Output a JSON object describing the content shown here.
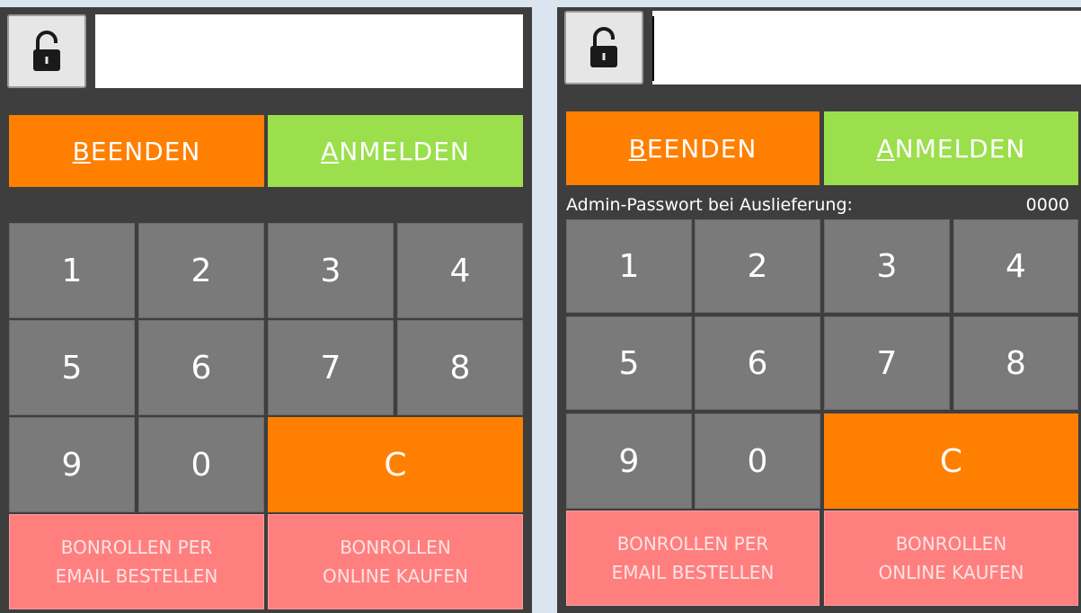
{
  "colors": {
    "orange": "#ff7f00",
    "green": "#9bdf4c",
    "pink": "#ff7f7f",
    "key_gray": "#7a7a7a",
    "panel_bg": "#3e3e3e"
  },
  "lock_icon": "padlock-unlocked-icon",
  "buttons": {
    "quit": {
      "underline": "B",
      "rest": "EENDEN"
    },
    "login": {
      "underline": "A",
      "rest": "NMELDEN"
    },
    "clear": "C",
    "order_email": {
      "line1": "BONROLLEN PER",
      "line2": "EMAIL BESTELLEN"
    },
    "buy_online": {
      "line1": "BONROLLEN",
      "line2": "ONLINE KAUFEN"
    }
  },
  "keys": [
    "1",
    "2",
    "3",
    "4",
    "5",
    "6",
    "7",
    "8",
    "9",
    "0"
  ],
  "admin_note": {
    "label": "Admin-Passwort bei Auslieferung:",
    "value": "0000"
  },
  "password_field": {
    "value": ""
  }
}
